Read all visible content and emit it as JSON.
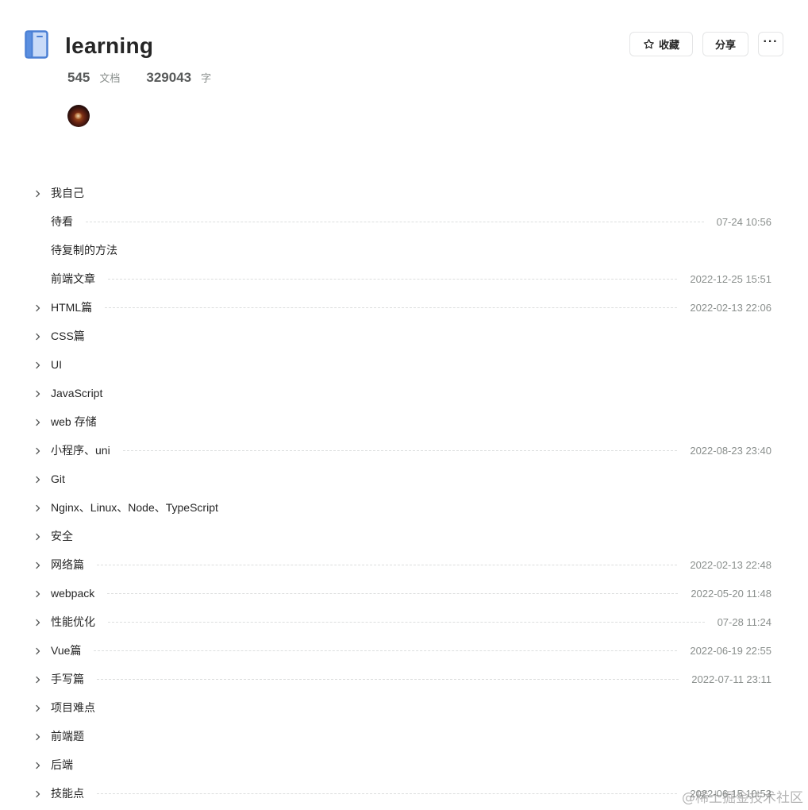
{
  "book": {
    "title": "learning",
    "doc_count": "545",
    "doc_unit": "文档",
    "word_count": "329043",
    "word_unit": "字"
  },
  "actions": {
    "collect_label": "收藏",
    "share_label": "分享",
    "more_label": "···"
  },
  "icons": {
    "book": "book-icon",
    "star": "star-outline-icon",
    "expand": "chevron-right-icon",
    "more": "more-horizontal-icon"
  },
  "colors": {
    "book_icon_fill": "#c9dbf8",
    "book_icon_stroke": "#4a7fd4",
    "text": "#262626",
    "muted": "#8a8f8d",
    "border": "#e4e5e6"
  },
  "tree": [
    {
      "label": "我自己",
      "date": "",
      "expandable": true
    },
    {
      "label": "待看",
      "date": "07-24 10:56",
      "expandable": false
    },
    {
      "label": "待复制的方法",
      "date": "",
      "expandable": false
    },
    {
      "label": "前端文章",
      "date": "2022-12-25 15:51",
      "expandable": false
    },
    {
      "label": "HTML篇",
      "date": "2022-02-13 22:06",
      "expandable": true
    },
    {
      "label": "CSS篇",
      "date": "",
      "expandable": true
    },
    {
      "label": "UI",
      "date": "",
      "expandable": true
    },
    {
      "label": "JavaScript",
      "date": "",
      "expandable": true
    },
    {
      "label": "web 存储",
      "date": "",
      "expandable": true
    },
    {
      "label": "小程序、uni",
      "date": "2022-08-23 23:40",
      "expandable": true
    },
    {
      "label": "Git",
      "date": "",
      "expandable": true
    },
    {
      "label": "Nginx、Linux、Node、TypeScript",
      "date": "",
      "expandable": true
    },
    {
      "label": "安全",
      "date": "",
      "expandable": true
    },
    {
      "label": "网络篇",
      "date": "2022-02-13 22:48",
      "expandable": true
    },
    {
      "label": "webpack",
      "date": "2022-05-20 11:48",
      "expandable": true
    },
    {
      "label": "性能优化",
      "date": "07-28 11:24",
      "expandable": true
    },
    {
      "label": "Vue篇",
      "date": "2022-06-19 22:55",
      "expandable": true
    },
    {
      "label": "手写篇",
      "date": "2022-07-11 23:11",
      "expandable": true
    },
    {
      "label": "项目难点",
      "date": "",
      "expandable": true
    },
    {
      "label": "前端题",
      "date": "",
      "expandable": true
    },
    {
      "label": "后端",
      "date": "",
      "expandable": true
    },
    {
      "label": "技能点",
      "date": "2022-06-15 10:53",
      "expandable": true
    }
  ],
  "watermark": "@稀土掘金技术社区"
}
